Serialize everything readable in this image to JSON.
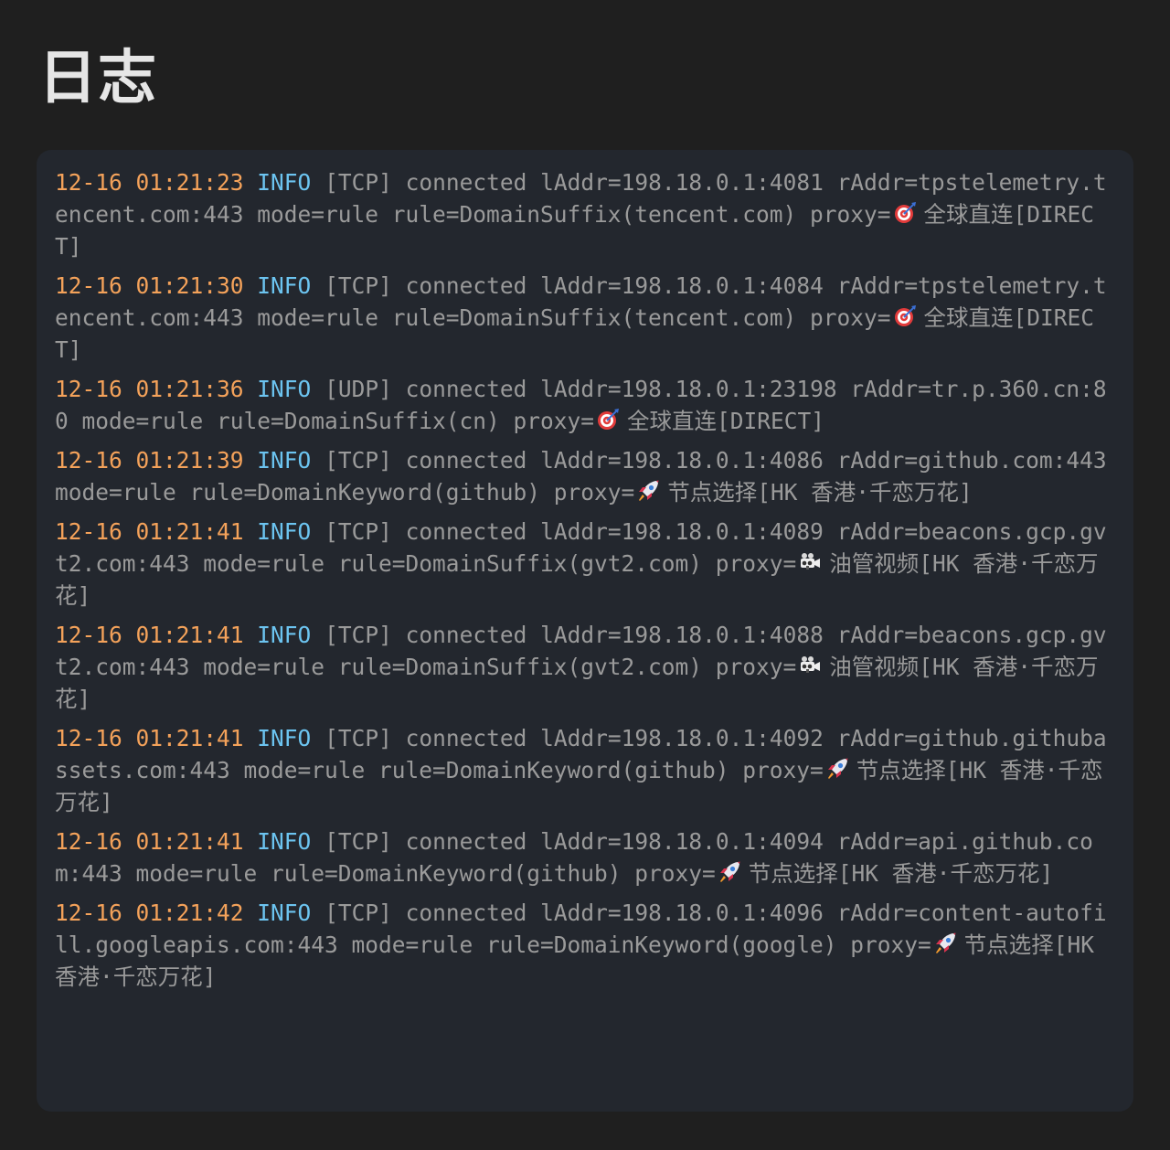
{
  "page": {
    "title": "日志"
  },
  "logs": [
    {
      "time": "12-16 01:21:23",
      "level": "INFO",
      "message": "[TCP] connected lAddr=198.18.0.1:4081 rAddr=tpstelemetry.tencent.com:443 mode=rule rule=DomainSuffix(tencent.com) proxy=",
      "proxy_icon": "target-icon",
      "proxy_name": "全球直连[DIRECT]"
    },
    {
      "time": "12-16 01:21:30",
      "level": "INFO",
      "message": "[TCP] connected lAddr=198.18.0.1:4084 rAddr=tpstelemetry.tencent.com:443 mode=rule rule=DomainSuffix(tencent.com) proxy=",
      "proxy_icon": "target-icon",
      "proxy_name": "全球直连[DIRECT]"
    },
    {
      "time": "12-16 01:21:36",
      "level": "INFO",
      "message": "[UDP] connected lAddr=198.18.0.1:23198 rAddr=tr.p.360.cn:80 mode=rule rule=DomainSuffix(cn) proxy=",
      "proxy_icon": "target-icon",
      "proxy_name": "全球直连[DIRECT]"
    },
    {
      "time": "12-16 01:21:39",
      "level": "INFO",
      "message": "[TCP] connected lAddr=198.18.0.1:4086 rAddr=github.com:443 mode=rule rule=DomainKeyword(github) proxy=",
      "proxy_icon": "rocket-icon",
      "proxy_name": "节点选择[HK 香港·千恋万花]"
    },
    {
      "time": "12-16 01:21:41",
      "level": "INFO",
      "message": "[TCP] connected lAddr=198.18.0.1:4089 rAddr=beacons.gcp.gvt2.com:443 mode=rule rule=DomainSuffix(gvt2.com) proxy=",
      "proxy_icon": "video-camera-icon",
      "proxy_name": "油管视频[HK 香港·千恋万花]"
    },
    {
      "time": "12-16 01:21:41",
      "level": "INFO",
      "message": "[TCP] connected lAddr=198.18.0.1:4088 rAddr=beacons.gcp.gvt2.com:443 mode=rule rule=DomainSuffix(gvt2.com) proxy=",
      "proxy_icon": "video-camera-icon",
      "proxy_name": "油管视频[HK 香港·千恋万花]"
    },
    {
      "time": "12-16 01:21:41",
      "level": "INFO",
      "message": "[TCP] connected lAddr=198.18.0.1:4092 rAddr=github.githubassets.com:443 mode=rule rule=DomainKeyword(github) proxy=",
      "proxy_icon": "rocket-icon",
      "proxy_name": "节点选择[HK 香港·千恋万花]"
    },
    {
      "time": "12-16 01:21:41",
      "level": "INFO",
      "message": "[TCP] connected lAddr=198.18.0.1:4094 rAddr=api.github.com:443 mode=rule rule=DomainKeyword(github) proxy=",
      "proxy_icon": "rocket-icon",
      "proxy_name": "节点选择[HK 香港·千恋万花]"
    },
    {
      "time": "12-16 01:21:42",
      "level": "INFO",
      "message": "[TCP] connected lAddr=198.18.0.1:4096 rAddr=content-autofill.googleapis.com:443 mode=rule rule=DomainKeyword(google) proxy=",
      "proxy_icon": "rocket-icon",
      "proxy_name": "节点选择[HK 香港·千恋万花]"
    }
  ],
  "colors": {
    "background": "#1f1f1f",
    "panel": "#23272e",
    "time": "#f4a25a",
    "level": "#6cc4f0",
    "text": "#9a9a9a",
    "title": "#e6e6e6"
  }
}
